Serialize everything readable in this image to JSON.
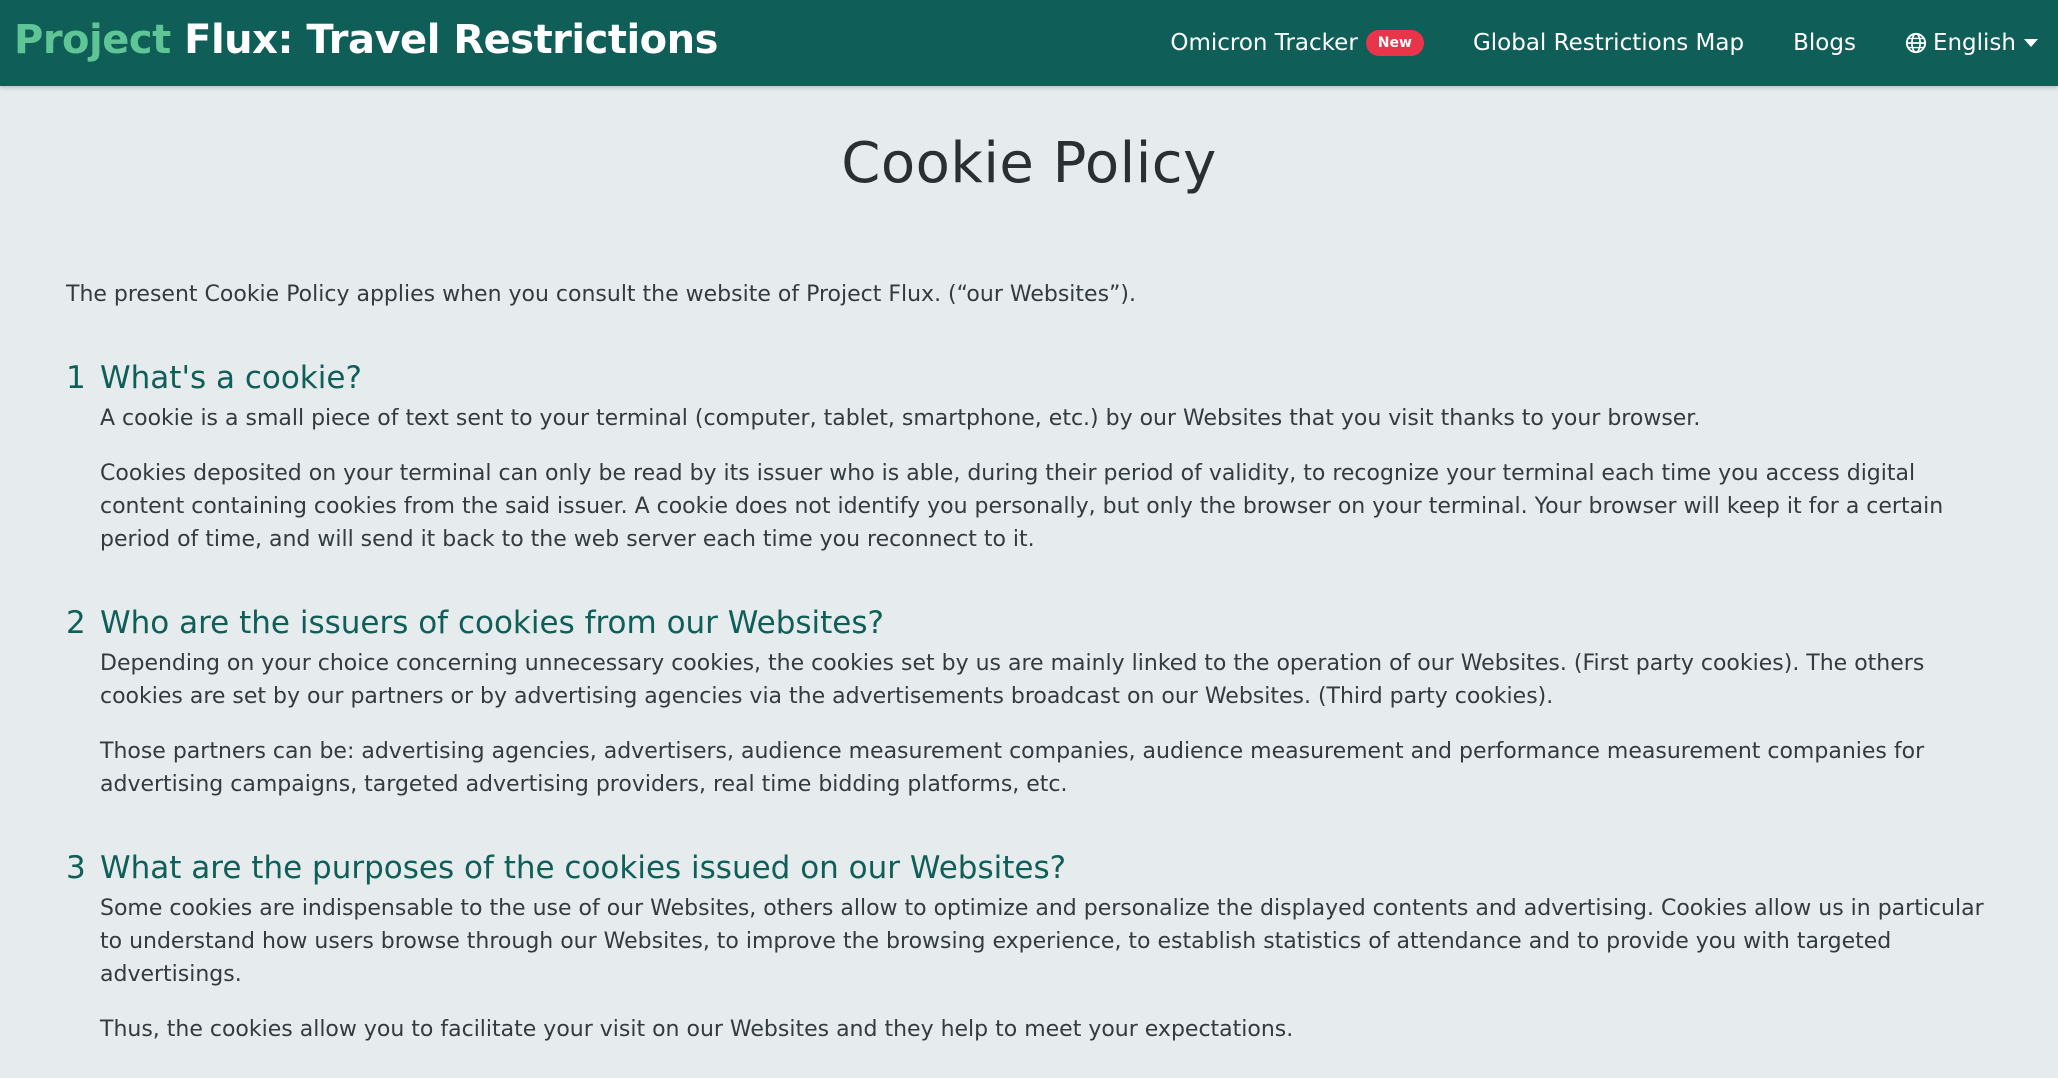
{
  "header": {
    "brand_accent": "Project",
    "brand_main": "Flux: Travel Restrictions",
    "nav": {
      "omicron_label": "Omicron Tracker",
      "omicron_badge": "New",
      "map_label": "Global Restrictions Map",
      "blogs_label": "Blogs",
      "language_label": "English"
    }
  },
  "main": {
    "title": "Cookie Policy",
    "intro": "The present Cookie Policy applies when you consult the website of Project Flux. (“our Websites”).",
    "sections": [
      {
        "number": "1",
        "heading": "What's a cookie?",
        "paragraphs": [
          "A cookie is a small piece of text sent to your terminal (computer, tablet, smartphone, etc.) by our Websites that you visit thanks to your browser.",
          "Cookies deposited on your terminal can only be read by its issuer who is able, during their period of validity, to recognize your terminal each time you access digital content containing cookies from the said issuer. A cookie does not identify you personally, but only the browser on your terminal. Your browser will keep it for a certain period of time, and will send it back to the web server each time you reconnect to it."
        ]
      },
      {
        "number": "2",
        "heading": "Who are the issuers of cookies from our Websites?",
        "paragraphs": [
          "Depending on your choice concerning unnecessary cookies, the cookies set by us are mainly linked to the operation of our Websites. (First party cookies). The others cookies are set by our partners or by advertising agencies via the advertisements broadcast on our Websites. (Third party cookies).",
          "Those partners can be: advertising agencies, advertisers, audience measurement companies, audience measurement and performance measurement companies for advertising campaigns, targeted advertising providers, real time bidding platforms, etc."
        ]
      },
      {
        "number": "3",
        "heading": "What are the purposes of the cookies issued on our Websites?",
        "paragraphs": [
          "Some cookies are indispensable to the use of our Websites, others allow to optimize and personalize the displayed contents and advertising. Cookies allow us in particular to understand how users browse through our Websites, to improve the browsing experience, to establish statistics of attendance and to provide you with targeted advertisings.",
          "Thus, the cookies allow you to facilitate your visit on our Websites and they help to meet your expectations."
        ]
      }
    ]
  },
  "colors": {
    "navbar": "#0f5e58",
    "brand_accent": "#5fc596",
    "badge": "#e8354a",
    "heading": "#0f5e58",
    "background": "#e6ebed"
  },
  "icons": {
    "language": "globe-icon",
    "dropdown": "caret-down-icon"
  }
}
